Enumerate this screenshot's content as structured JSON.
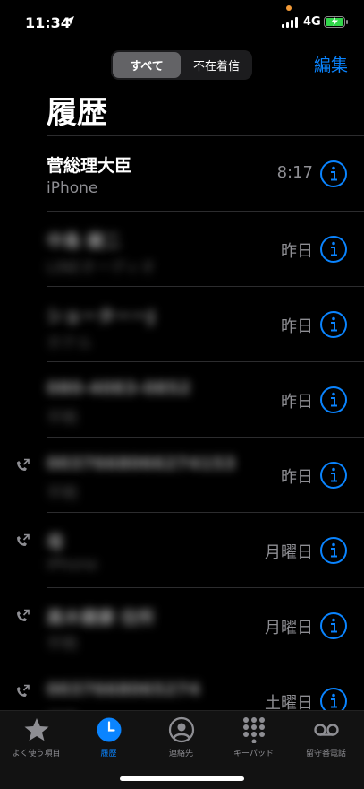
{
  "status_bar": {
    "time": "11:34",
    "network": "4G"
  },
  "header": {
    "segments": [
      "すべて",
      "不在着信"
    ],
    "edit_label": "編集",
    "title": "履歴"
  },
  "calls": [
    {
      "name": "菅総理大臣",
      "sub": "iPhone",
      "when": "8:17",
      "outgoing": false,
      "redacted": false
    },
    {
      "name": "中島 健二",
      "sub": "LINEオーディオ",
      "when": "昨日",
      "outgoing": false,
      "redacted": true
    },
    {
      "name": "ショーターーJ",
      "sub": "ホテル",
      "when": "昨日",
      "outgoing": false,
      "redacted": true
    },
    {
      "name": "080-4083-0852",
      "sub": "不明",
      "when": "昨日",
      "outgoing": false,
      "redacted": true
    },
    {
      "name": "0037668066274153",
      "sub": "不明",
      "when": "昨日",
      "outgoing": true,
      "redacted": true
    },
    {
      "name": "母",
      "sub": "iPhone",
      "when": "月曜日",
      "outgoing": true,
      "redacted": true
    },
    {
      "name": "高木健康 住所",
      "sub": "不明",
      "when": "月曜日",
      "outgoing": true,
      "redacted": true
    },
    {
      "name": "0037668065274",
      "sub": "不明",
      "when": "土曜日",
      "outgoing": true,
      "redacted": true
    }
  ],
  "tabs": [
    {
      "label": "よく使う項目",
      "icon": "star-icon",
      "active": false
    },
    {
      "label": "履歴",
      "icon": "clock-icon",
      "active": true
    },
    {
      "label": "連絡先",
      "icon": "contact-icon",
      "active": false
    },
    {
      "label": "キーパッド",
      "icon": "keypad-icon",
      "active": false
    },
    {
      "label": "留守番電話",
      "icon": "voicemail-icon",
      "active": false
    }
  ],
  "colors": {
    "accent": "#0a84ff",
    "secondary_text": "#8e8e93",
    "battery": "#32d74b"
  }
}
